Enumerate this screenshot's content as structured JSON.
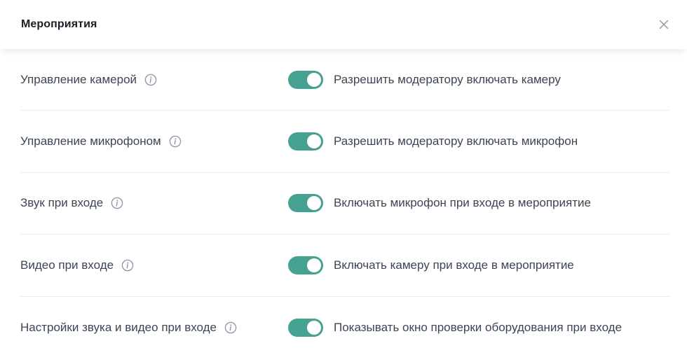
{
  "dialog": {
    "title": "Мероприятия",
    "close_icon": "close-icon"
  },
  "colors": {
    "toggle_on": "#45a190",
    "text": "#3b4553",
    "divider": "#e9ecef"
  },
  "settings": [
    {
      "label": "Управление камерой",
      "info_icon": "info-icon",
      "toggle_on": true,
      "description": "Разрешить модератору включать камеру"
    },
    {
      "label": "Управление микрофоном",
      "info_icon": "info-icon",
      "toggle_on": true,
      "description": "Разрешить модератору включать микрофон"
    },
    {
      "label": "Звук при входе",
      "info_icon": "info-icon",
      "toggle_on": true,
      "description": "Включать микрофон при входе в мероприятие"
    },
    {
      "label": "Видео при входе",
      "info_icon": "info-icon",
      "toggle_on": true,
      "description": "Включать камеру при входе в мероприятие"
    },
    {
      "label": "Настройки звука и видео при входе",
      "info_icon": "info-icon",
      "toggle_on": true,
      "description": "Показывать окно проверки оборудования при входе"
    }
  ]
}
